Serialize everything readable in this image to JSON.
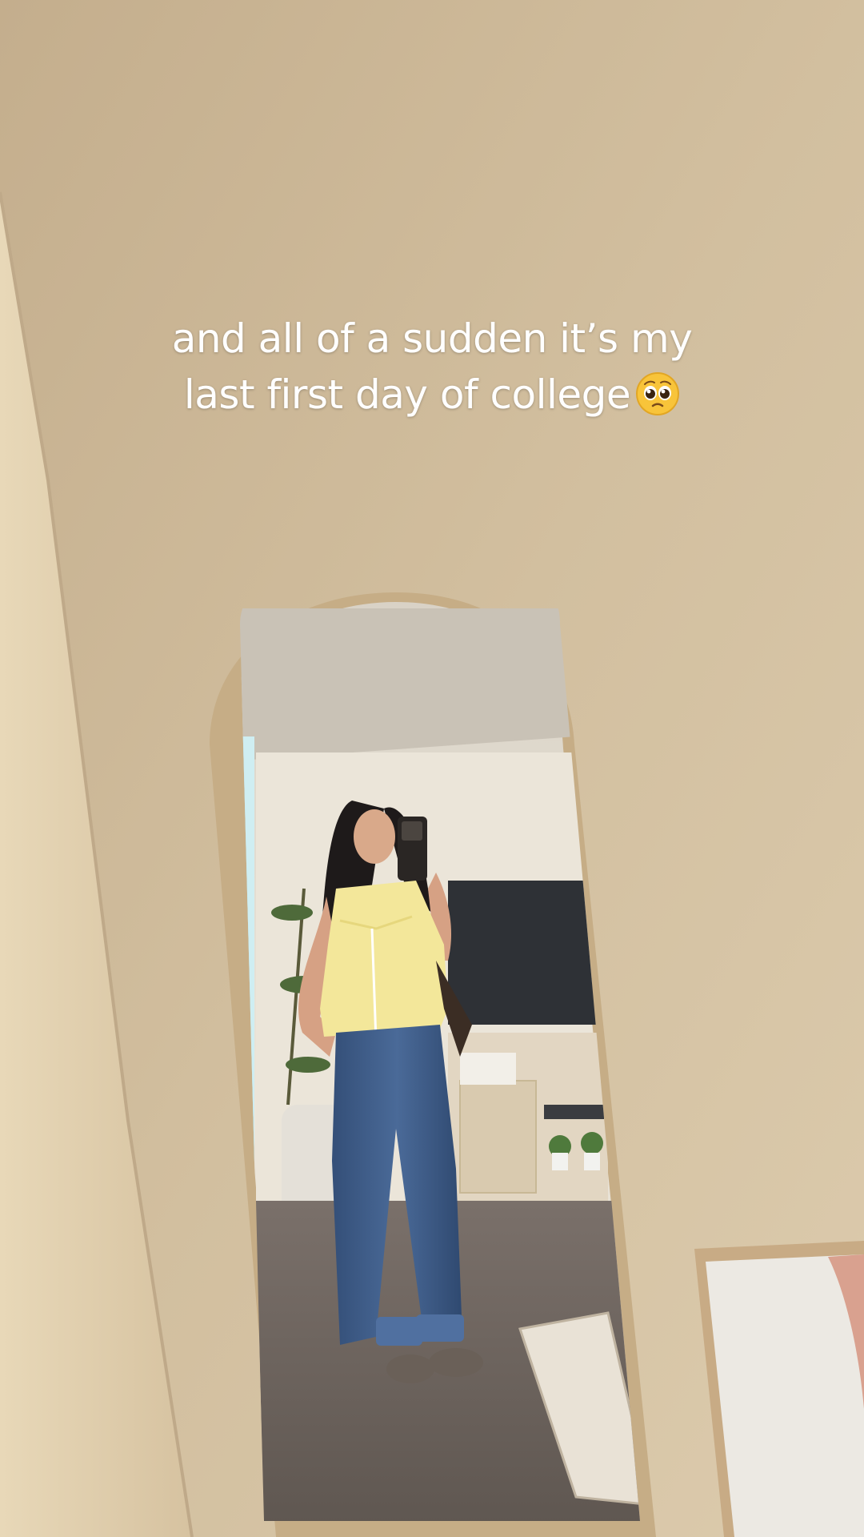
{
  "caption": {
    "line1": "and all of a sudden it’s my",
    "line2": "last first day of college",
    "emoji_icon": "pleading-face-emoji"
  },
  "colors": {
    "wall": "#cdb998",
    "wall_light": "#e4d5b9",
    "mirror_frame": "#c8b08a",
    "floor": "#6e655f",
    "top": "#f3e79a",
    "jeans": "#3c5a86",
    "tv": "#2e3136",
    "caption_text": "#ffffff"
  }
}
